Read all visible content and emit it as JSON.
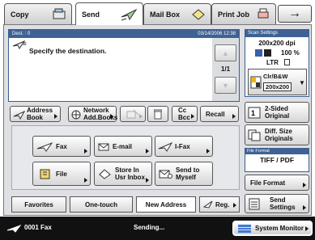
{
  "tabs": [
    {
      "label": "Copy",
      "icon": "copy-icon"
    },
    {
      "label": "Send",
      "icon": "send-icon"
    },
    {
      "label": "Mail Box",
      "icon": "mailbox-icon"
    },
    {
      "label": "Print Job",
      "icon": "printjob-icon"
    }
  ],
  "nav": {
    "next_arrow": "→"
  },
  "destination": {
    "header_left": "Dest. :  0",
    "header_right": "03/14/2006 12:38",
    "message": "Specify the destination.",
    "page": "1/1"
  },
  "scan_settings": {
    "title": "Scan Settings",
    "resolution": "200x200 dpi",
    "zoom": "100 %",
    "size": "LTR",
    "color_mode": "Clr/B&W",
    "color_res": "200x200"
  },
  "toolbar": {
    "address_book_1": "Address",
    "address_book_2": "Book",
    "network_1": "Network",
    "network_2": "Add.Books",
    "cc_1": "Cc",
    "cc_2": "Bcc",
    "recall": "Recall"
  },
  "options": {
    "two_sided_1": "2-Sided",
    "two_sided_2": "Original",
    "diff_size_1": "Diff. Size",
    "diff_size_2": "Originals",
    "file_format_title": "File Format",
    "file_format_value": "TIFF / PDF",
    "file_format_button": "File Format",
    "send_settings_1": "Send",
    "send_settings_2": "Settings"
  },
  "functions": {
    "fax": "Fax",
    "email": "E-mail",
    "ifax": "I-Fax",
    "file": "File",
    "store_1": "Store In",
    "store_2": "Usr Inbox",
    "sendmyself_1": "Send to",
    "sendmyself_2": "Myself"
  },
  "bottom_tabs": {
    "favorites": "Favorites",
    "one_touch": "One-touch",
    "new_address": "New Address",
    "reg": "Reg."
  },
  "status": {
    "job": "0001  Fax",
    "message": "Sending...",
    "system_monitor": "System Monitor"
  }
}
